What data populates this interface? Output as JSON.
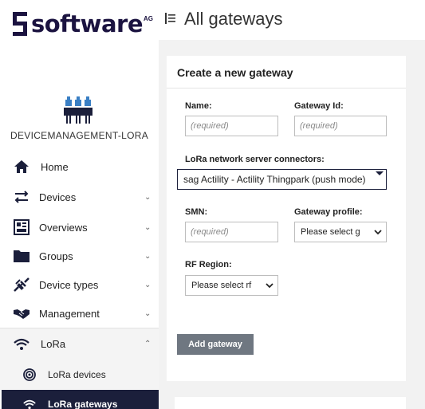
{
  "brand": {
    "wordmark": "software",
    "suffix": "AG"
  },
  "tenant": {
    "name": "DEVICEMANAGEMENT-LORA"
  },
  "nav": {
    "home": "Home",
    "devices": "Devices",
    "overviews": "Overviews",
    "groups": "Groups",
    "device_types": "Device types",
    "management": "Management",
    "lora": "LoRa",
    "lora_devices": "LoRa devices",
    "lora_gateways": "LoRa gateways",
    "collapsed_chevron": "⌄",
    "expanded_chevron": "⌃"
  },
  "header": {
    "title": "All gateways"
  },
  "form": {
    "title": "Create a new gateway",
    "name_label": "Name:",
    "name_placeholder": "(required)",
    "gateway_id_label": "Gateway Id:",
    "gateway_id_placeholder": "(required)",
    "connector_label": "LoRa network server connectors:",
    "connector_value": "sag Actility - Actility Thingpark (push mode)",
    "smn_label": "SMN:",
    "smn_placeholder": "(required)",
    "profile_label": "Gateway profile:",
    "profile_value": "Please select g",
    "region_label": "RF Region:",
    "region_value": "Please select rf",
    "submit_label": "Add gateway"
  },
  "colors": {
    "brand_navy": "#1b1340",
    "active_nav_bg": "#1b1f3b",
    "button_gray": "#6f7781",
    "device_icon_blue": "#3a7fc4"
  }
}
